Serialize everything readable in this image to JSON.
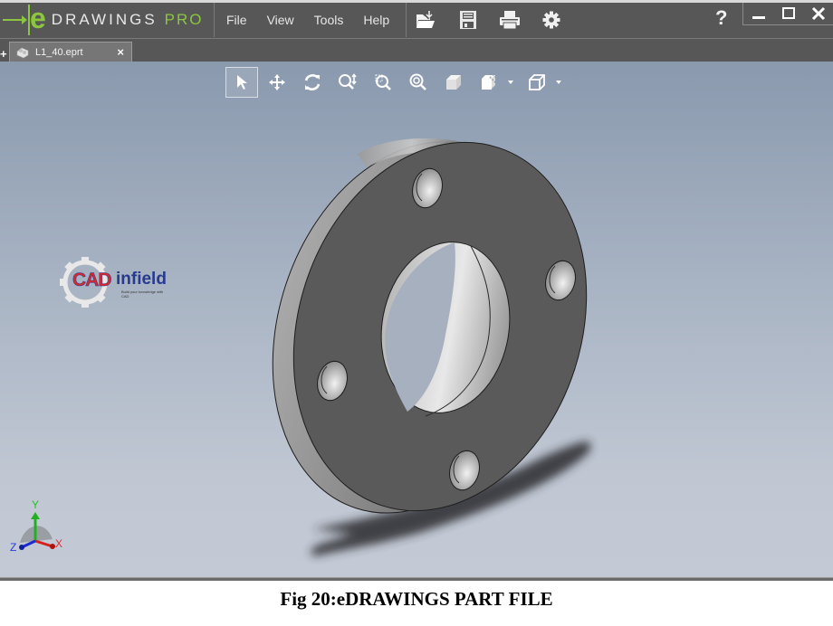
{
  "app": {
    "logo": {
      "e": "e",
      "drawings": "DRAWINGS",
      "registered": "°",
      "edition": "PRO"
    },
    "brand_color": "#8cc63f",
    "menu": [
      "File",
      "View",
      "Tools",
      "Help"
    ],
    "toolbar_icons": [
      "open-icon",
      "save-icon",
      "print-icon",
      "settings-icon"
    ],
    "help_label": "?",
    "window_controls": [
      "minimize",
      "maximize",
      "close"
    ]
  },
  "tabs": {
    "new_tab_label": "+",
    "items": [
      {
        "label": "L1_40.eprt",
        "icon": "part-icon",
        "close_label": "×",
        "active": true
      }
    ]
  },
  "view_toolbar": {
    "tools": [
      {
        "name": "select",
        "active": true
      },
      {
        "name": "pan",
        "active": false
      },
      {
        "name": "rotate",
        "active": false
      },
      {
        "name": "zoom-in-out",
        "active": false
      },
      {
        "name": "zoom-to-area",
        "active": false
      },
      {
        "name": "zoom-to-fit",
        "active": false
      },
      {
        "name": "shaded",
        "active": false
      },
      {
        "name": "section",
        "active": false,
        "dropdown": true
      },
      {
        "name": "views",
        "active": false,
        "dropdown": true
      }
    ]
  },
  "viewport": {
    "model_name": "L1_40.eprt",
    "watermark": {
      "brand_left": "CAD",
      "brand_right": "infield",
      "tagline": "Build your knowledge with CAD"
    },
    "triad": {
      "x": "X",
      "y": "Y",
      "z": "Z"
    },
    "axis_colors": {
      "x": "#d42020",
      "y": "#22b022",
      "z": "#1a2ad0"
    }
  },
  "caption": "Fig 20:eDRAWINGS PART FILE"
}
